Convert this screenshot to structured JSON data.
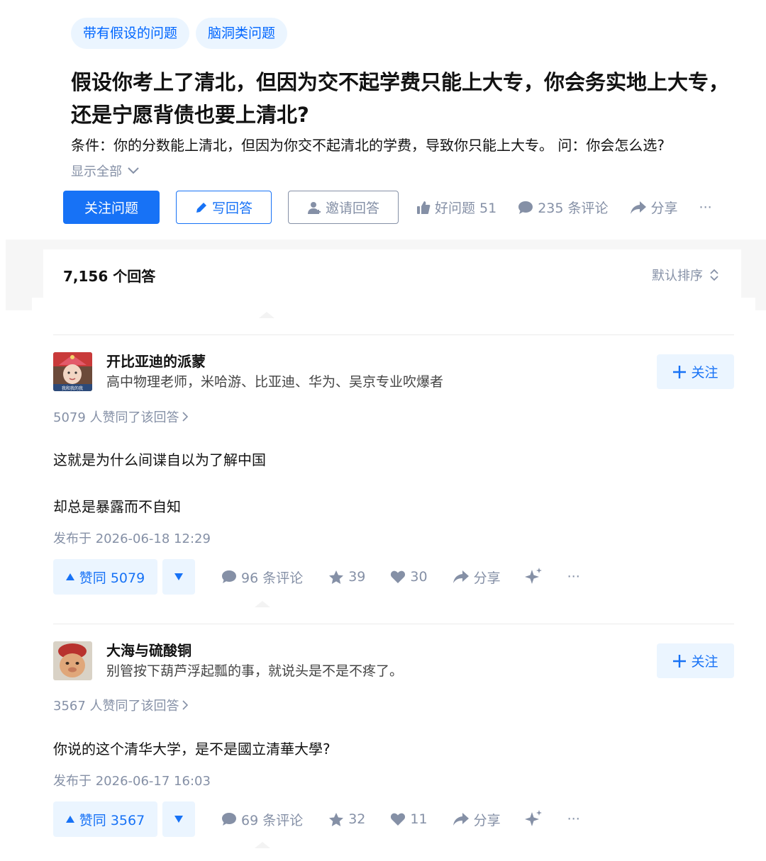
{
  "question": {
    "topics": [
      "带有假设的问题",
      "脑洞类问题"
    ],
    "title": "假设你考上了清北，但因为交不起学费只能上大专，你会务实地上大专，还是宁愿背债也要上清北?",
    "detail": "条件：你的分数能上清北，但因为你交不起清北的学费，导致你只能上大专。 问：你会怎么选?",
    "show_all": "显示全部"
  },
  "actions": {
    "follow_question": "关注问题",
    "write_answer": "写回答",
    "invite_answer": "邀请回答",
    "good_question": "好问题 51",
    "comments": "235 条评论",
    "share": "分享",
    "more": "···"
  },
  "answers_header": {
    "count": "7,156 个回答",
    "sort": "默认排序"
  },
  "answers": [
    {
      "author_name": "开比亚迪的派蒙",
      "author_bio": "高中物理老师，米哈游、比亚迪、华为、吴京专业吹爆者",
      "avatar_caption": "我和我的我",
      "follow": "关注",
      "vote_summary": "5079 人赞同了该回答",
      "paragraphs": [
        "这就是为什么间谍自以为了解中国",
        "却总是暴露而不自知"
      ],
      "published": "发布于 2026-06-18 12:29",
      "upvote": "赞同 5079",
      "comments": "96 条评论",
      "favorites": "39",
      "likes": "30",
      "share": "分享",
      "more": "···"
    },
    {
      "author_name": "大海与硫酸铜",
      "author_bio": "别管按下葫芦浮起瓢的事，就说头是不是不疼了。",
      "follow": "关注",
      "vote_summary": "3567 人赞同了该回答",
      "paragraphs": [
        "你说的这个清华大学，是不是國立清華大學?"
      ],
      "published": "发布于 2026-06-17 16:03",
      "upvote": "赞同 3567",
      "comments": "69 条评论",
      "favorites": "32",
      "likes": "11",
      "share": "分享",
      "more": "···"
    }
  ],
  "colors": {
    "brand": "#1772f6",
    "brand_light": "#ebf5ff",
    "muted": "#8590a6",
    "text": "#121212"
  }
}
